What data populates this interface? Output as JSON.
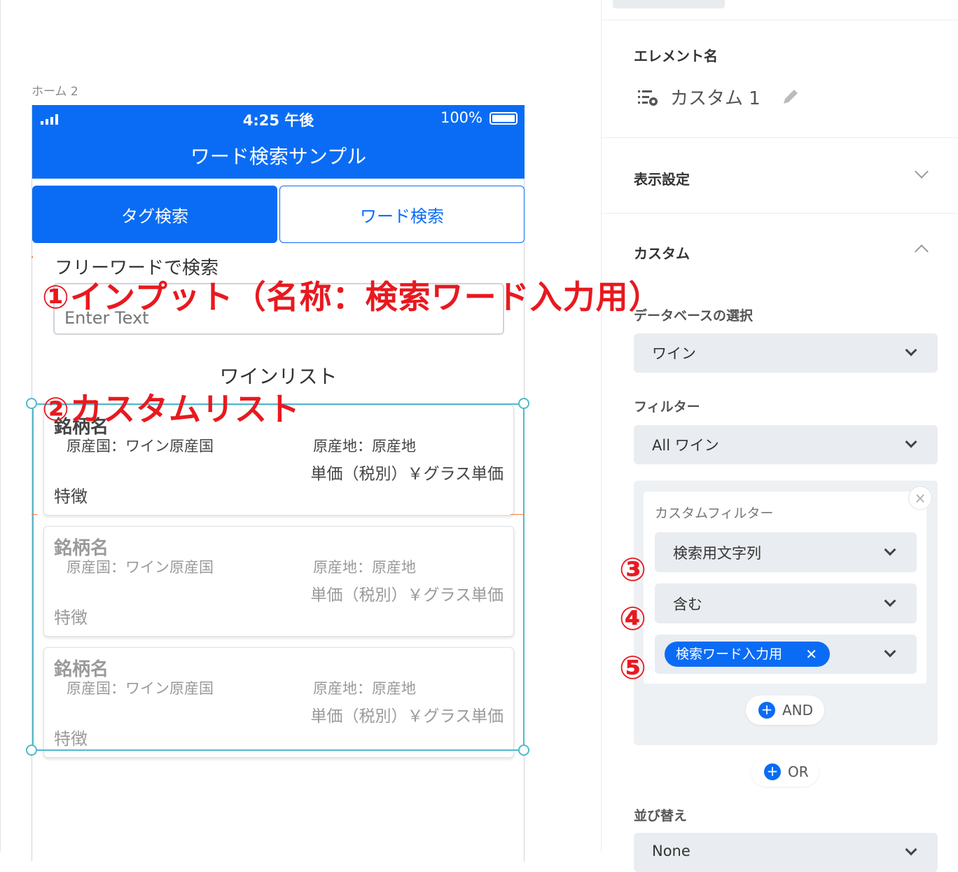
{
  "canvas": {
    "screen_label": "ホーム 2"
  },
  "phone": {
    "status_time": "4:25 午後",
    "status_battery": "100%",
    "title": "ワード検索サンプル",
    "tabs": [
      {
        "label": "タグ検索"
      },
      {
        "label": "ワード検索"
      }
    ],
    "search_label": "フリーワードで検索",
    "search_placeholder": "Enter Text",
    "list_heading": "ワインリスト",
    "cards": [
      {
        "name": "銘柄名",
        "origin": "原産国：ワイン原産国",
        "region": "原産地：原産地",
        "price": "単価（税別）￥グラス単価",
        "feature": "特徴"
      },
      {
        "name": "銘柄名",
        "origin": "原産国：ワイン原産国",
        "region": "原産地：原産地",
        "price": "単価（税別）￥グラス単価",
        "feature": "特徴"
      },
      {
        "name": "銘柄名",
        "origin": "原産国：ワイン原産国",
        "region": "原産地：原産地",
        "price": "単価（税別）￥グラス単価",
        "feature": "特徴"
      }
    ]
  },
  "annotations": {
    "input": "①インプット（名称：検索ワード入力用）",
    "custom_list": "②カスタムリスト",
    "n3": "③",
    "n4": "④",
    "n5": "⑤",
    "color": "#e8191f"
  },
  "panel": {
    "element_name_title": "エレメント名",
    "element_name": "カスタム 1",
    "display_settings": "表示設定",
    "custom_title": "カスタム",
    "db_label": "データベースの選択",
    "db_value": "ワイン",
    "filter_label": "フィルター",
    "filter_value": "All ワイン",
    "custom_filter_title": "カスタムフィルター",
    "cf_field": "検索用文字列",
    "cf_operator": "含む",
    "cf_value_chip": "検索ワード入力用",
    "and_label": "AND",
    "or_label": "OR",
    "sort_label": "並び替え",
    "sort_value": "None"
  },
  "colors": {
    "accent": "#0a6cf5",
    "selection": "#4fb9cc"
  }
}
